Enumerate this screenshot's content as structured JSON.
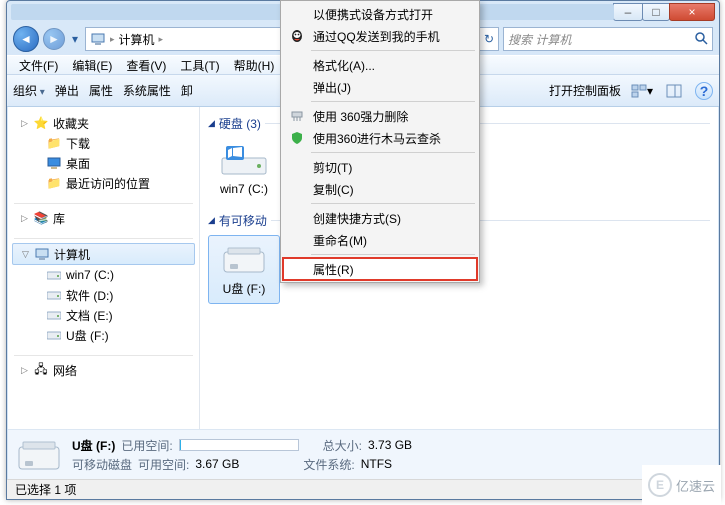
{
  "window": {
    "title_blur": "",
    "min": "–",
    "max": "□",
    "close": "×"
  },
  "nav": {
    "back": "◄",
    "fwd": "►",
    "drop": "▾",
    "breadcrumb_root_icon": "computer-icon",
    "breadcrumb_root": "计算机",
    "chev": "▸",
    "search_placeholder": "搜索 计算机"
  },
  "menubar": {
    "file": "文件(F)",
    "edit": "编辑(E)",
    "view": "查看(V)",
    "tools": "工具(T)",
    "help": "帮助(H)"
  },
  "toolbar": {
    "org": "组织",
    "eject": "弹出",
    "props": "属性",
    "sysprops": "系统属性",
    "uninst_trunc": "卸",
    "ctrlpanel": "打开控制面板"
  },
  "tree": {
    "favorites": "收藏夹",
    "downloads": "下载",
    "desktop": "桌面",
    "recent": "最近访问的位置",
    "libraries": "库",
    "computer": "计算机",
    "drives": {
      "win7": "win7 (C:)",
      "soft": "软件 (D:)",
      "doc": "文档 (E:)",
      "usb": "U盘 (F:)"
    },
    "network": "网络"
  },
  "main": {
    "section_hdd": "硬盘 (3)",
    "section_removable_trunc": "有可移动",
    "drive_win7": "win7 (C:)",
    "drive_usb": "U盘 (F:)"
  },
  "details": {
    "name": "U盘 (F:)",
    "type": "可移动磁盘",
    "used_label": "已用空间:",
    "used_value": "",
    "free_label": "可用空间:",
    "free_value": "3.67 GB",
    "total_label": "总大小:",
    "total_value": "3.73 GB",
    "fs_label": "文件系统:",
    "fs_value": "NTFS"
  },
  "status": {
    "text": "已选择 1 项"
  },
  "context_menu": {
    "items": [
      {
        "label": "以便携式设备方式打开"
      },
      {
        "label": "通过QQ发送到我的手机",
        "icon": "qq-icon"
      },
      {
        "sep": true
      },
      {
        "label": "格式化(A)..."
      },
      {
        "label": "弹出(J)"
      },
      {
        "sep": true
      },
      {
        "label": "使用 360强力删除",
        "icon": "shredder-icon"
      },
      {
        "label": "使用360进行木马云查杀",
        "icon": "shield-360-icon"
      },
      {
        "sep": true
      },
      {
        "label": "剪切(T)"
      },
      {
        "label": "复制(C)"
      },
      {
        "sep": true
      },
      {
        "label": "创建快捷方式(S)"
      },
      {
        "label": "重命名(M)"
      },
      {
        "sep": true
      },
      {
        "label": "属性(R)",
        "highlight": true
      }
    ]
  },
  "watermark": {
    "logo": "E",
    "text": "亿速云"
  }
}
